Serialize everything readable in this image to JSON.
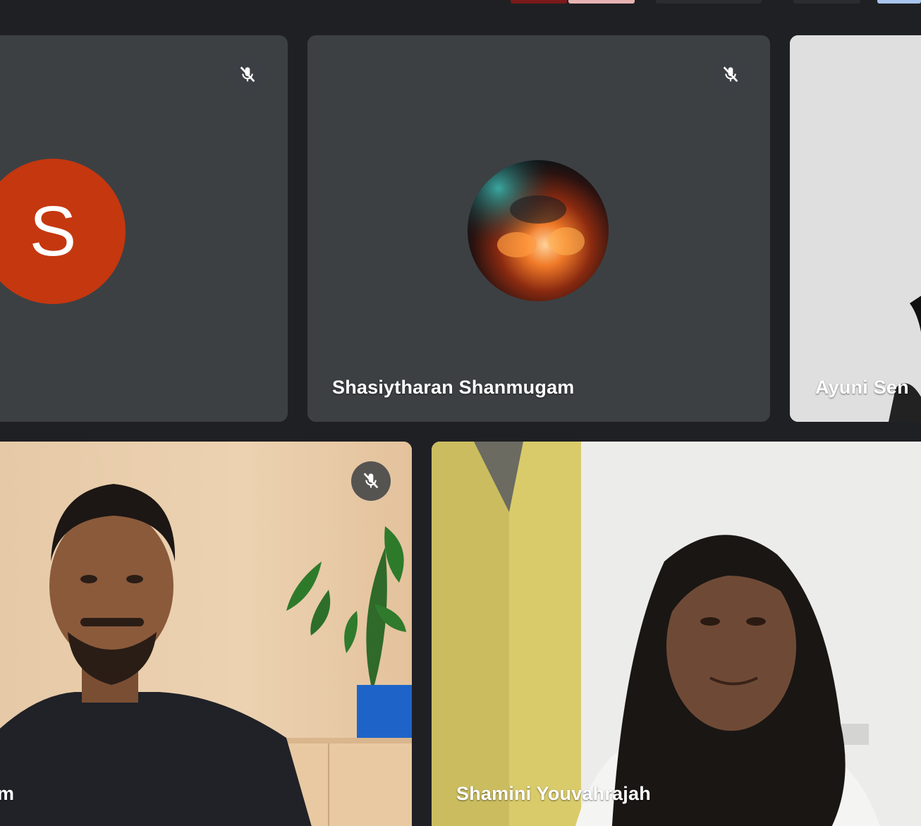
{
  "participants": [
    {
      "name": "",
      "avatar_letter": "S",
      "avatar_color": "#c5370f",
      "muted": true,
      "type": "avatar-letter"
    },
    {
      "name": "Shasiytharan Shanmugam",
      "muted": true,
      "type": "avatar-photo"
    },
    {
      "name": "Ayuni Sen",
      "muted": false,
      "type": "video"
    },
    {
      "name": "m",
      "muted": true,
      "type": "video"
    },
    {
      "name": "Shamini Youvahrajah",
      "muted": false,
      "type": "video"
    }
  ],
  "icons": {
    "mute": "mic-off-icon"
  },
  "colors": {
    "tile_background": "#3c4043",
    "app_background": "#202124",
    "text": "#ffffff"
  }
}
